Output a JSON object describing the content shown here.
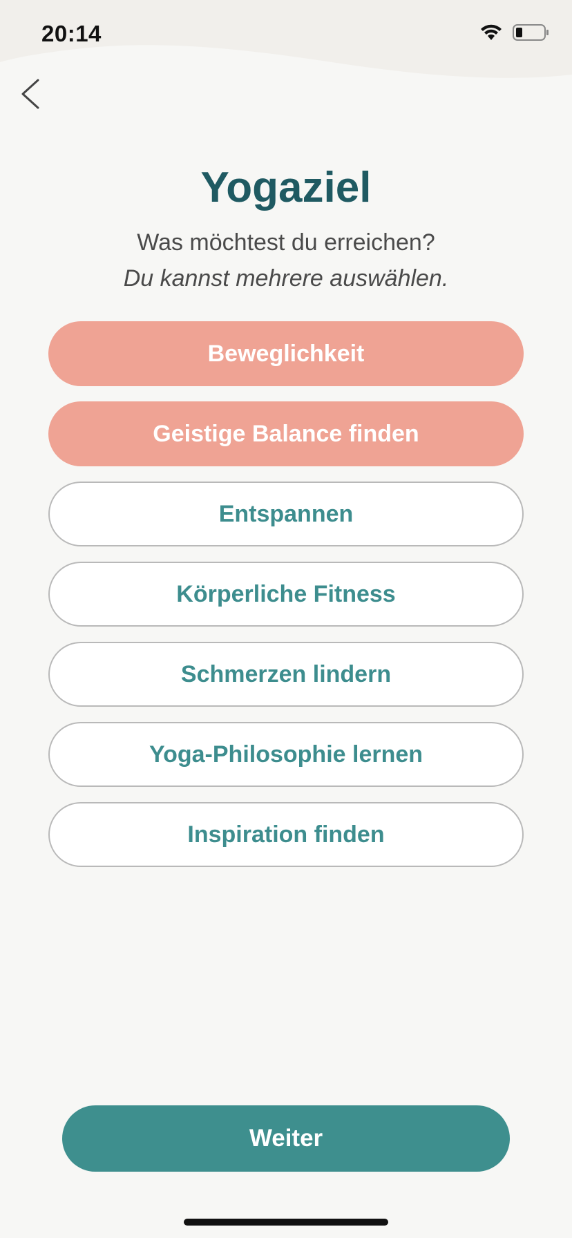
{
  "status_bar": {
    "time": "20:14"
  },
  "icons": {
    "back": "chevron-left-icon",
    "wifi": "wifi-icon",
    "battery": "battery-icon"
  },
  "header": {
    "title": "Yogaziel",
    "subtitle": "Was möchtest du erreichen?",
    "hint": "Du kannst mehrere auswählen."
  },
  "options": [
    {
      "label": "Beweglichkeit",
      "selected": true
    },
    {
      "label": "Geistige Balance finden",
      "selected": true
    },
    {
      "label": "Entspannen",
      "selected": false
    },
    {
      "label": "Körperliche Fitness",
      "selected": false
    },
    {
      "label": "Schmerzen lindern",
      "selected": false
    },
    {
      "label": "Yoga-Philosophie lernen",
      "selected": false
    },
    {
      "label": "Inspiration finden",
      "selected": false
    }
  ],
  "footer": {
    "next_label": "Weiter"
  },
  "colors": {
    "background": "#f7f7f5",
    "header_wave": "#f1efeb",
    "title": "#1f5a62",
    "selected_fill": "#efa394",
    "unselected_text": "#3d8d8e",
    "primary_button": "#3e8f8e"
  }
}
